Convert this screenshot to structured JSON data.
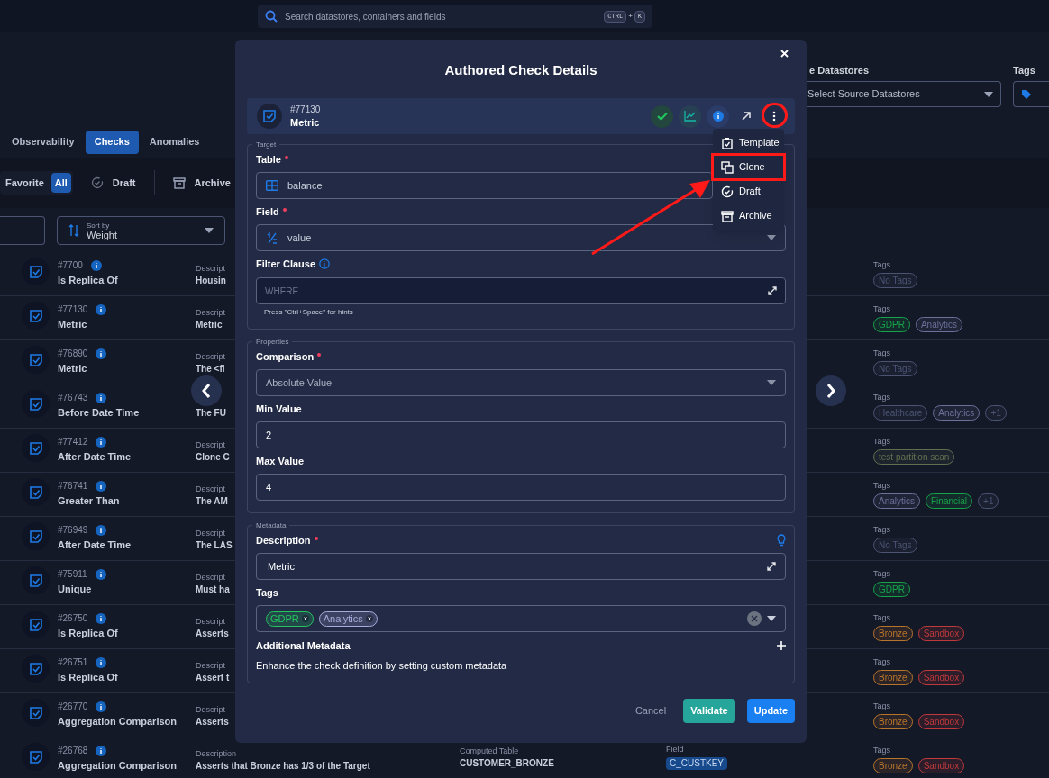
{
  "top_search": {
    "placeholder": "Search datastores, containers and fields",
    "keys": [
      "CTRL",
      "+",
      "K"
    ]
  },
  "source_datastores": {
    "label": "e Datastores",
    "placeholder": "Select Source Datastores"
  },
  "tags_filter": {
    "label": "Tags"
  },
  "tabs": [
    {
      "label": "Observability",
      "selected": false
    },
    {
      "label": "Checks",
      "selected": true
    },
    {
      "label": "Anomalies",
      "selected": false
    }
  ],
  "status_filters": [
    {
      "label": "Favorite",
      "selected": false
    },
    {
      "label": "All",
      "selected": true
    }
  ],
  "filter_buttons": [
    {
      "label": "Draft",
      "kind": "draft"
    },
    {
      "label": "Archive",
      "kind": "archive"
    }
  ],
  "sort": {
    "label": "Sort by",
    "value": "Weight"
  },
  "checks": [
    {
      "id": "#7700",
      "name": "Is Replica Of",
      "description_label": "Descript",
      "description": "Housin",
      "tags_label": "Tags",
      "tags": [
        {
          "label": "No Tags",
          "color": "#4b5573"
        }
      ]
    },
    {
      "id": "#77130",
      "name": "Metric",
      "description_label": "Descript",
      "description": "Metric",
      "tags_label": "Tags",
      "tags": [
        {
          "label": "GDPR",
          "color": "#16a34a"
        },
        {
          "label": "Analytics",
          "color": "#6b7199"
        }
      ]
    },
    {
      "id": "#76890",
      "name": "Metric",
      "description_label": "Descript",
      "description": "The <fi",
      "tags_label": "Tags",
      "tags": [
        {
          "label": "No Tags",
          "color": "#4b5573"
        }
      ]
    },
    {
      "id": "#76743",
      "name": "Before Date Time",
      "description": "The FU",
      "tags_label": "Tags",
      "tags": [
        {
          "label": "Healthcare",
          "color": "#4b5573"
        },
        {
          "label": "Analytics",
          "color": "#6b7199"
        },
        {
          "label": "+1",
          "color": "#4b5573"
        }
      ]
    },
    {
      "id": "#77412",
      "name": "After Date Time",
      "description_label": "Descript",
      "description": "Clone C",
      "tags_label": "Tags",
      "tags": [
        {
          "label": "test partition scan",
          "color": "#5f7050"
        }
      ]
    },
    {
      "id": "#76741",
      "name": "Greater Than",
      "description_label": "Descript",
      "description": "The AM",
      "tags_label": "Tags",
      "tags": [
        {
          "label": "Analytics",
          "color": "#6b7199"
        },
        {
          "label": "Financial",
          "color": "#16a34a"
        },
        {
          "label": "+1",
          "color": "#4b5573"
        }
      ]
    },
    {
      "id": "#76949",
      "name": "After Date Time",
      "description_label": "Descript",
      "description": "The LAS",
      "tags_label": "Tags",
      "tags": [
        {
          "label": "No Tags",
          "color": "#4b5573"
        }
      ]
    },
    {
      "id": "#75911",
      "name": "Unique",
      "description_label": "Descript",
      "description": "Must ha",
      "tags_label": "Tags",
      "tags": [
        {
          "label": "GDPR",
          "color": "#16a34a"
        }
      ]
    },
    {
      "id": "#26750",
      "name": "Is Replica Of",
      "description_label": "Descript",
      "description": "Asserts",
      "tags_label": "Tags",
      "tags": [
        {
          "label": "Bronze",
          "color": "#b8742a"
        },
        {
          "label": "Sandbox",
          "color": "#c0393b"
        }
      ]
    },
    {
      "id": "#26751",
      "name": "Is Replica Of",
      "description_label": "Descript",
      "description": "Assert t",
      "tags_label": "Tags",
      "tags": [
        {
          "label": "Bronze",
          "color": "#b8742a"
        },
        {
          "label": "Sandbox",
          "color": "#c0393b"
        }
      ]
    },
    {
      "id": "#26770",
      "name": "Aggregation Comparison",
      "description_label": "Descript",
      "description": "Asserts",
      "tags_label": "Tags",
      "tags": [
        {
          "label": "Bronze",
          "color": "#b8742a"
        },
        {
          "label": "Sandbox",
          "color": "#c0393b"
        }
      ]
    },
    {
      "id": "#26768",
      "name": "Aggregation Comparison",
      "description_label": "Description",
      "description": "Asserts that Bronze has 1/3 of the Target",
      "computed_table": {
        "label": "Computed Table",
        "value": "CUSTOMER_BRONZE"
      },
      "field": {
        "label": "Field",
        "value": "C_CUSTKEY"
      },
      "tags_label": "Tags",
      "tags": [
        {
          "label": "Bronze",
          "color": "#b8742a"
        },
        {
          "label": "Sandbox",
          "color": "#c0393b"
        }
      ]
    }
  ],
  "modal": {
    "title": "Authored Check Details",
    "check": {
      "id": "#77130",
      "name": "Metric"
    },
    "menu": [
      {
        "label": "Template",
        "kind": "template",
        "annotated": false
      },
      {
        "label": "Clone",
        "kind": "clone",
        "annotated": true
      },
      {
        "label": "Draft",
        "kind": "draft",
        "annotated": false
      },
      {
        "label": "Archive",
        "kind": "archive",
        "annotated": false
      }
    ],
    "target": {
      "legend": "Target",
      "table": {
        "label": "Table",
        "required": true,
        "value": "balance"
      },
      "field": {
        "label": "Field",
        "required": true,
        "value": "value"
      },
      "filter_clause": {
        "label": "Filter Clause",
        "placeholder": "WHERE",
        "hint": "Press \"Ctrl+Space\" for hints"
      }
    },
    "properties": {
      "legend": "Properties",
      "comparison": {
        "label": "Comparison",
        "required": true,
        "value": "Absolute Value"
      },
      "min_value": {
        "label": "Min Value",
        "required": false,
        "value": "2"
      },
      "max_value": {
        "label": "Max Value",
        "required": false,
        "value": "4"
      }
    },
    "metadata": {
      "legend": "Metadata",
      "description": {
        "label": "Description",
        "required": true,
        "value": "Metric"
      },
      "tags": {
        "label": "Tags",
        "items": [
          {
            "label": "GDPR",
            "color": "#22c55e"
          },
          {
            "label": "Analytics",
            "color": "#a5acd9"
          }
        ]
      },
      "additional": {
        "label": "Additional Metadata",
        "text": "Enhance the check definition by setting custom metadata"
      }
    },
    "buttons": {
      "cancel": "Cancel",
      "validate": "Validate",
      "update": "Update"
    }
  }
}
